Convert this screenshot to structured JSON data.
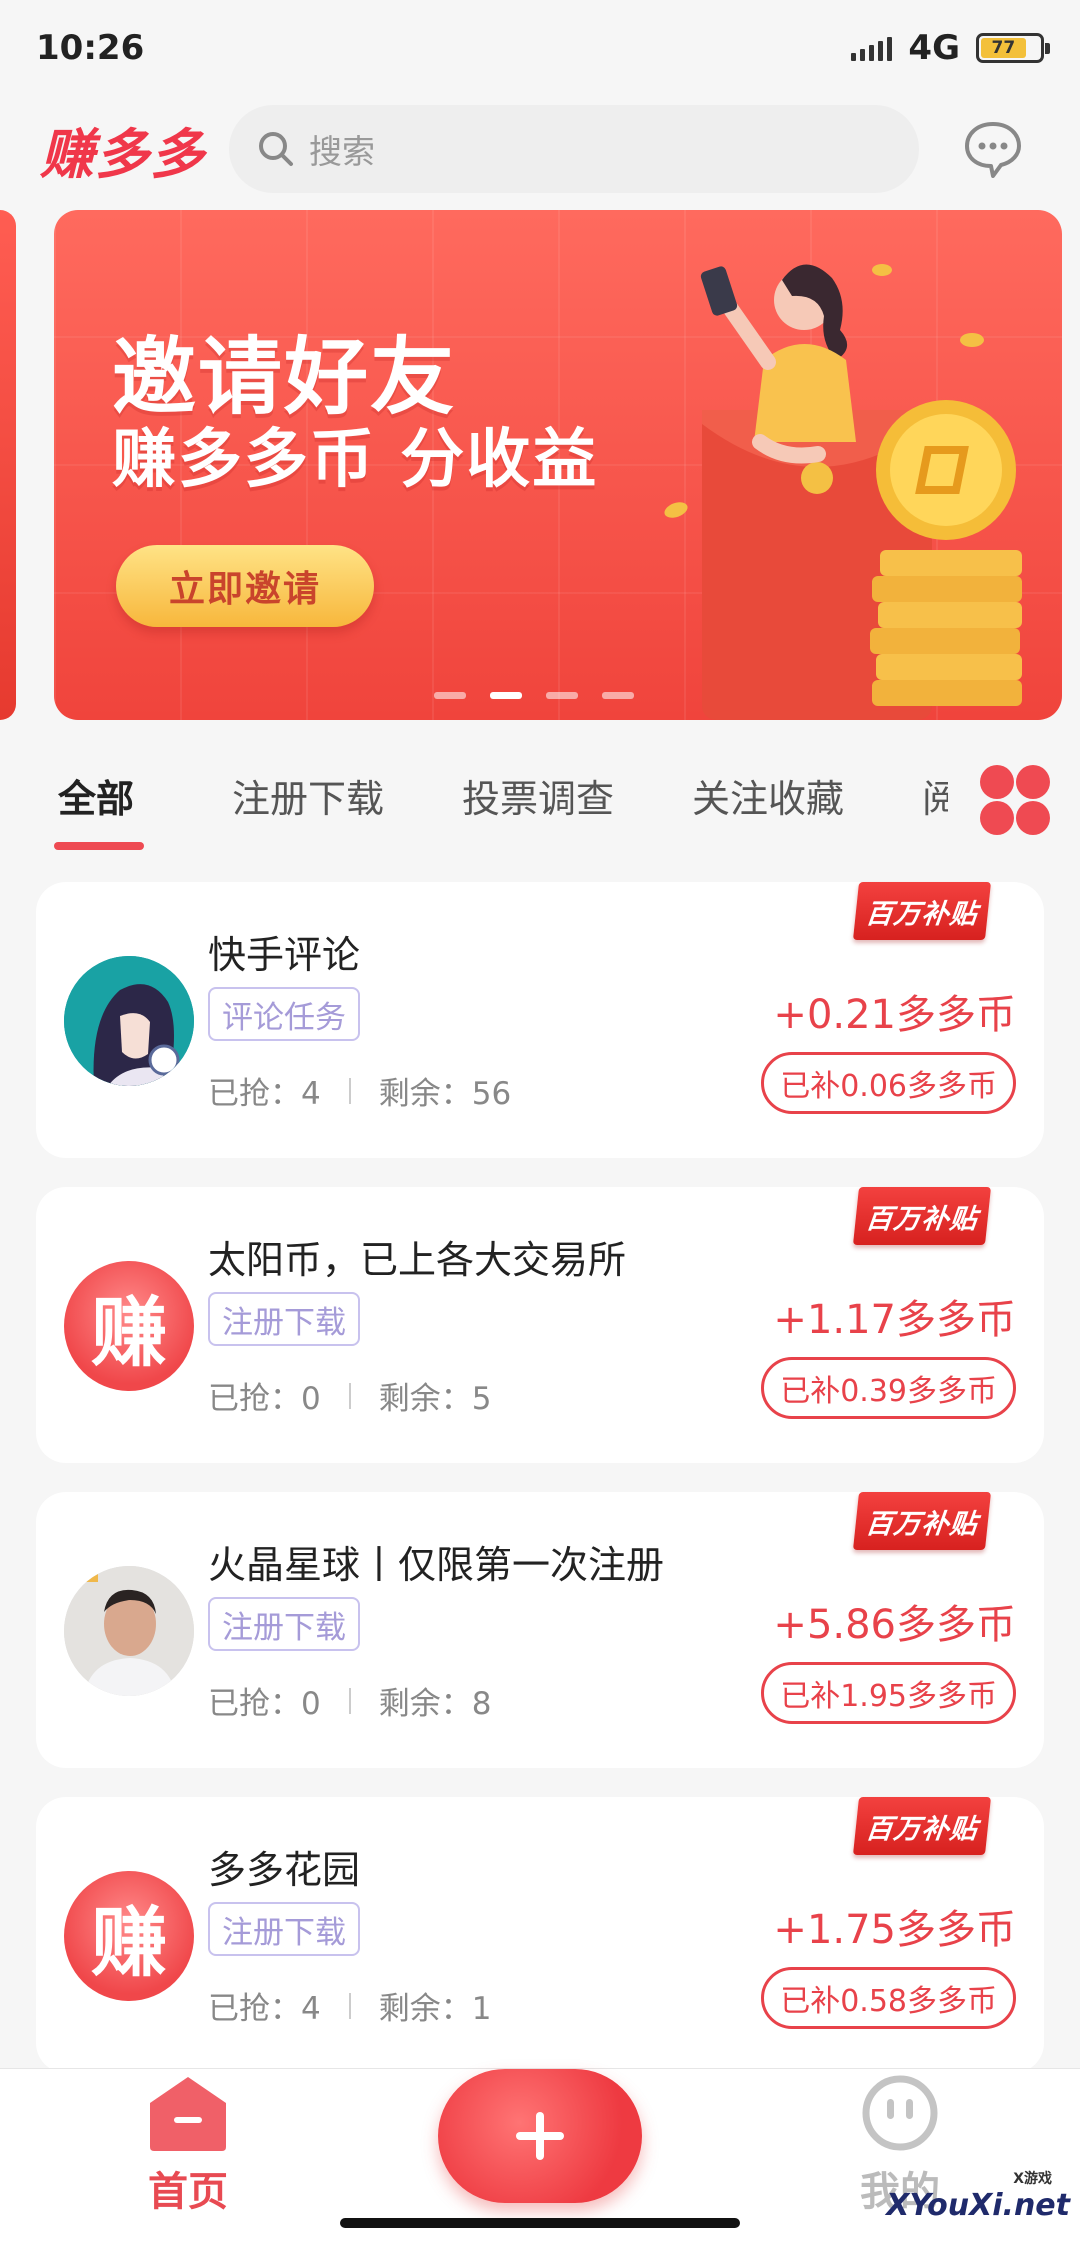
{
  "status_bar": {
    "time": "10:26",
    "network": "4G",
    "battery": "77"
  },
  "header": {
    "logo": "赚多多",
    "search_placeholder": "搜索"
  },
  "banner": {
    "title": "邀请好友",
    "subtitle": "赚多多币 分收益",
    "button_label": "立即邀请",
    "active_slide": 2,
    "slide_count": 4
  },
  "tabs": [
    {
      "label": "全部",
      "active": true
    },
    {
      "label": "注册下载",
      "active": false
    },
    {
      "label": "投票调查",
      "active": false
    },
    {
      "label": "关注收藏",
      "active": false
    },
    {
      "label": "阅",
      "active": false
    }
  ],
  "tasks": [
    {
      "badge": "百万补贴",
      "title": "快手评论",
      "tag": "评论任务",
      "grabbed": "已抢：4",
      "remaining": "剩余：56",
      "reward": "+0.21多多币",
      "subsidy": "已补0.06多多币",
      "avatar": "anime-avatar"
    },
    {
      "badge": "百万补贴",
      "title": "太阳币，已上各大交易所",
      "tag": "注册下载",
      "grabbed": "已抢：0",
      "remaining": "剩余：5",
      "reward": "+1.17多多币",
      "subsidy": "已补0.39多多币",
      "avatar": "赚"
    },
    {
      "badge": "百万补贴",
      "title": "火晶星球丨仅限第一次注册",
      "tag": "注册下载",
      "grabbed": "已抢：0",
      "remaining": "剩余：8",
      "reward": "+5.86多多币",
      "subsidy": "已补1.95多多币",
      "avatar": "person-avatar"
    },
    {
      "badge": "百万补贴",
      "title": "多多花园",
      "tag": "注册下载",
      "grabbed": "已抢：4",
      "remaining": "剩余：1",
      "reward": "+1.75多多币",
      "subsidy": "已补0.58多多币",
      "avatar": "赚"
    }
  ],
  "bottom_nav": {
    "home_label": "首页",
    "me_label": "我的"
  },
  "watermark": {
    "text": "XYouXi.net",
    "small": "X游戏"
  },
  "colors": {
    "accent": "#e8424a",
    "tag_purple": "#a59bd8",
    "banner_red": "#f0443c"
  }
}
